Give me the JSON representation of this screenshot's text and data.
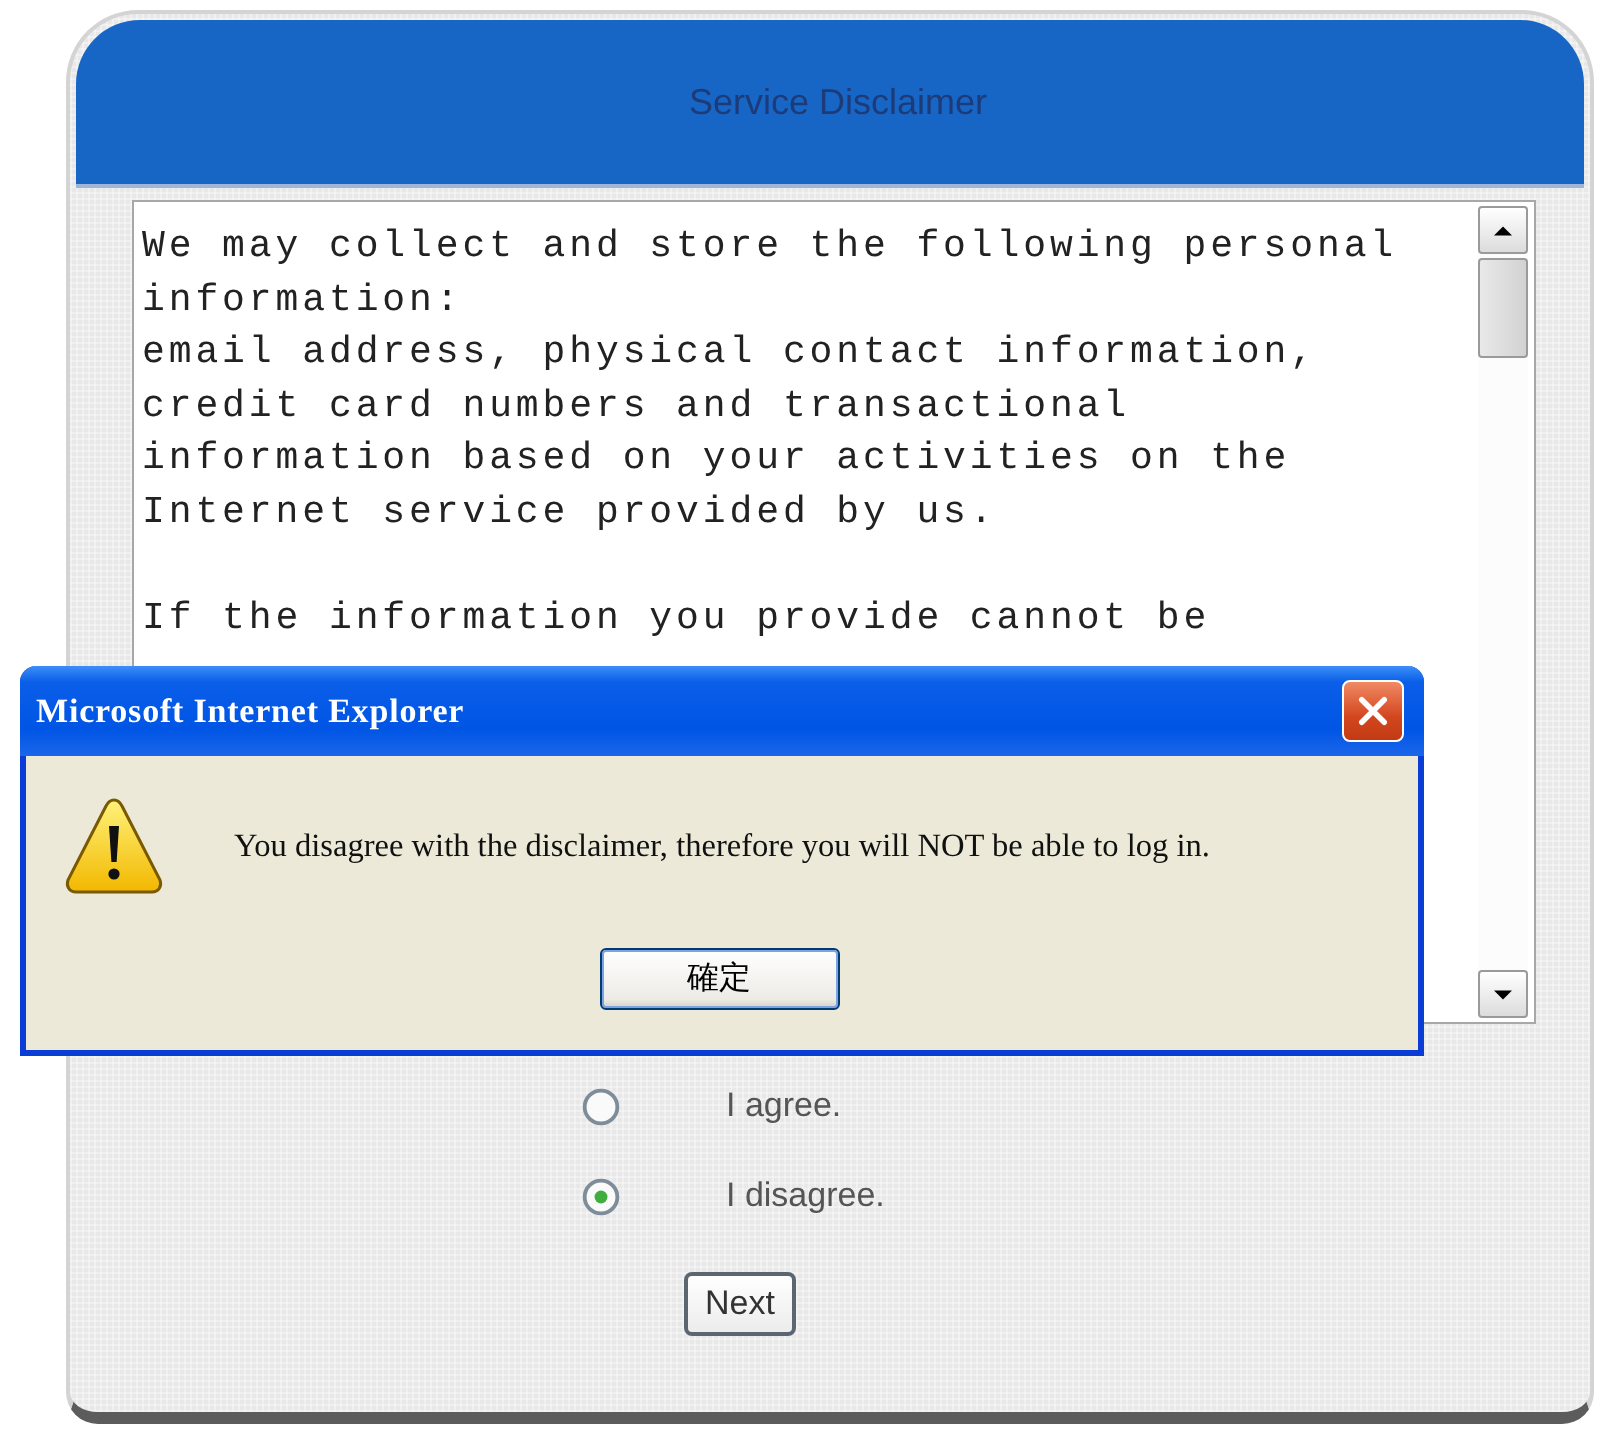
{
  "panel": {
    "title": "Service Disclaimer"
  },
  "disclaimer": {
    "paragraphs": [
      {
        "parts": [
          "We may collect and store the following personal information:",
          "email address, physical contact information, credit card numbers and transactional information based on your activities on the Internet service provided by us."
        ]
      },
      {
        "parts": [
          "If the information you provide cannot be"
        ]
      }
    ]
  },
  "options": [
    {
      "label": "I agree.",
      "selected": false
    },
    {
      "label": "I disagree.",
      "selected": true
    }
  ],
  "next_button": {
    "label": "Next"
  },
  "dialog": {
    "title": "Microsoft Internet Explorer",
    "message": "You disagree with the disclaimer, therefore you will NOT be able to log in.",
    "buttons": [
      "確定"
    ]
  }
}
